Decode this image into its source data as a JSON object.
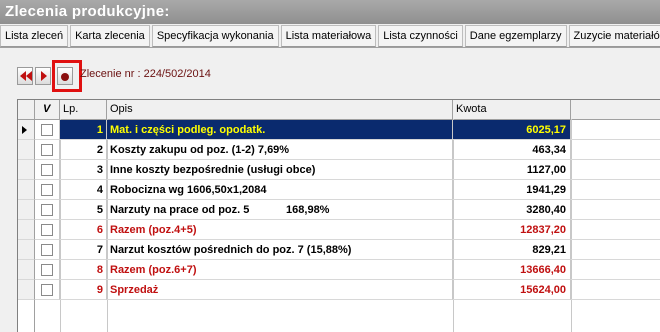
{
  "window": {
    "title": "Zlecenia produkcyjne:"
  },
  "tabs": [
    {
      "label": "Lista zleceń"
    },
    {
      "label": "Karta zlecenia"
    },
    {
      "label": "Specyfikacja wykonania"
    },
    {
      "label": "Lista materiałowa"
    },
    {
      "label": "Lista czynności"
    },
    {
      "label": "Dane egzemplarzy"
    },
    {
      "label": "Zuzycie materiałó"
    }
  ],
  "toolbar": {
    "icons": [
      "first-record-icon",
      "next-record-icon",
      "record-icon"
    ],
    "order_label": "Zlecenie nr : 224/502/2014"
  },
  "grid": {
    "headers": {
      "check": "V",
      "lp": "Lp.",
      "opis": "Opis",
      "kwota": "Kwota"
    },
    "rows": [
      {
        "lp": "1",
        "opis": "Mat. i części podleg. opodatk.",
        "kwota": "6025,17",
        "style": "selected"
      },
      {
        "lp": "2",
        "opis": "Koszty zakupu od poz. (1-2) 7,69%",
        "kwota": "463,34",
        "style": "normal"
      },
      {
        "lp": "3",
        "opis": "Inne koszty bezpośrednie (usługi obce)",
        "kwota": "1127,00",
        "style": "normal"
      },
      {
        "lp": "4",
        "opis": "Robocizna wg 1606,50x1,2084",
        "kwota": "1941,29",
        "style": "normal"
      },
      {
        "lp": "5",
        "opis": "Narzuty na prace od poz. 5            168,98%",
        "kwota": "3280,40",
        "style": "normal"
      },
      {
        "lp": "6",
        "opis": "Razem (poz.4+5)",
        "kwota": "12837,20",
        "style": "red"
      },
      {
        "lp": "7",
        "opis": "Narzut kosztów pośrednich do poz. 7 (15,88%)",
        "kwota": "829,21",
        "style": "normal"
      },
      {
        "lp": "8",
        "opis": "Razem (poz.6+7)",
        "kwota": "13666,40",
        "style": "red"
      },
      {
        "lp": "9",
        "opis": "Sprzedaż",
        "kwota": "15624,00",
        "style": "red"
      }
    ]
  },
  "colors": {
    "selected_bg": "#0a2a6e",
    "selected_fg": "#ffff00",
    "red_text": "#c01010",
    "highlight": "#e01010"
  }
}
